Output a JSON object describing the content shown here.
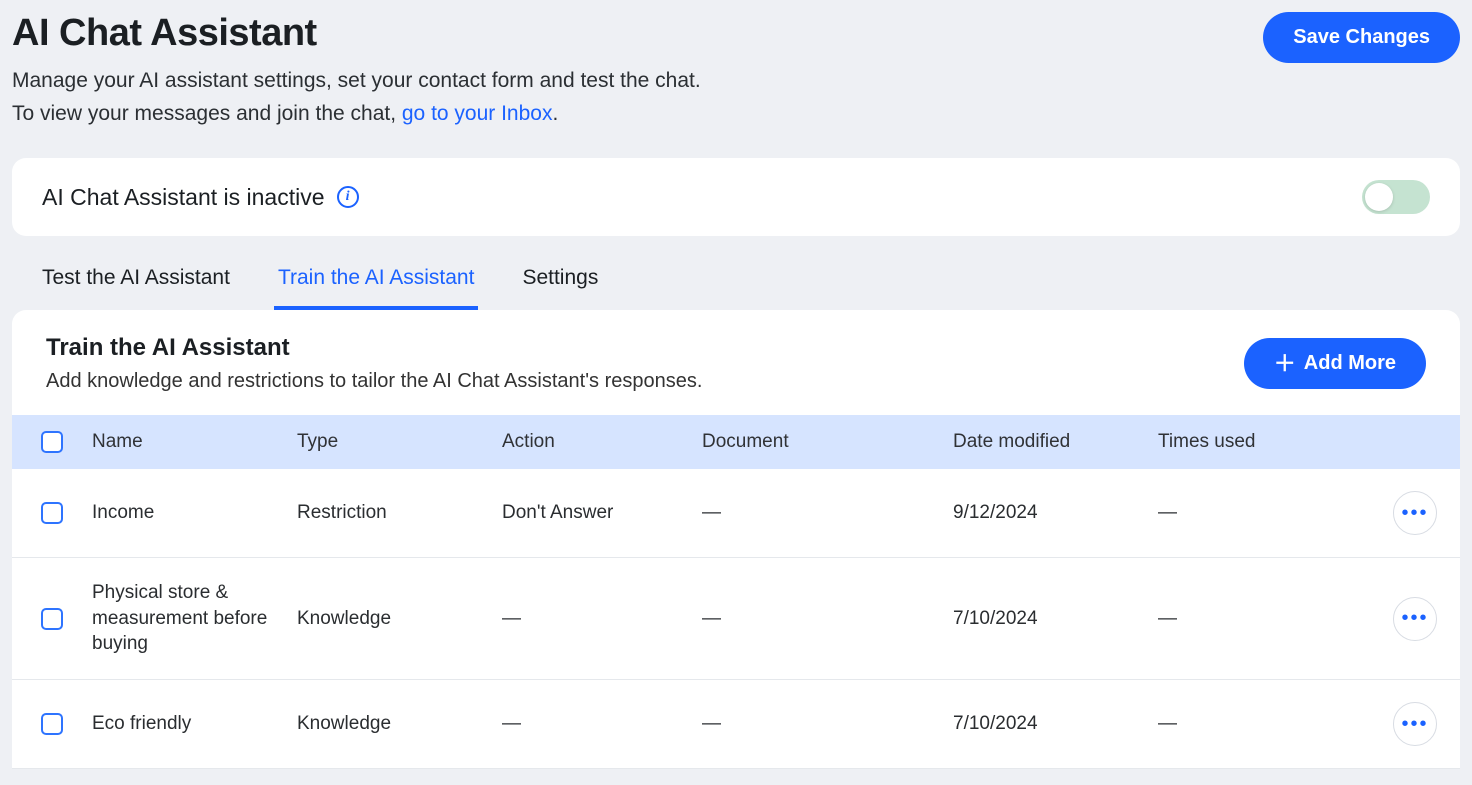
{
  "header": {
    "title": "AI Chat Assistant",
    "subtitle_line1": "Manage your AI assistant settings, set your contact form and test the chat.",
    "subtitle_line2_prefix": "To view your messages and join the chat, ",
    "subtitle_link": "go to your Inbox",
    "subtitle_suffix": ".",
    "save_button": "Save Changes"
  },
  "status": {
    "text": "AI Chat Assistant is inactive",
    "toggle_on": false
  },
  "tabs": [
    {
      "label": "Test the AI Assistant",
      "active": false
    },
    {
      "label": "Train the AI Assistant",
      "active": true
    },
    {
      "label": "Settings",
      "active": false
    }
  ],
  "panel": {
    "title": "Train the AI Assistant",
    "subtitle": "Add knowledge and restrictions to tailor the AI Chat Assistant's responses.",
    "add_button": "Add More"
  },
  "table": {
    "columns": [
      "Name",
      "Type",
      "Action",
      "Document",
      "Date modified",
      "Times used"
    ],
    "rows": [
      {
        "name": "Income",
        "type": "Restriction",
        "action": "Don't Answer",
        "document": "—",
        "date_modified": "9/12/2024",
        "times_used": "—"
      },
      {
        "name": "Physical store & measurement before buying",
        "type": "Knowledge",
        "action": "—",
        "document": "—",
        "date_modified": "7/10/2024",
        "times_used": "—"
      },
      {
        "name": "Eco friendly",
        "type": "Knowledge",
        "action": "—",
        "document": "—",
        "date_modified": "7/10/2024",
        "times_used": "—"
      }
    ]
  }
}
